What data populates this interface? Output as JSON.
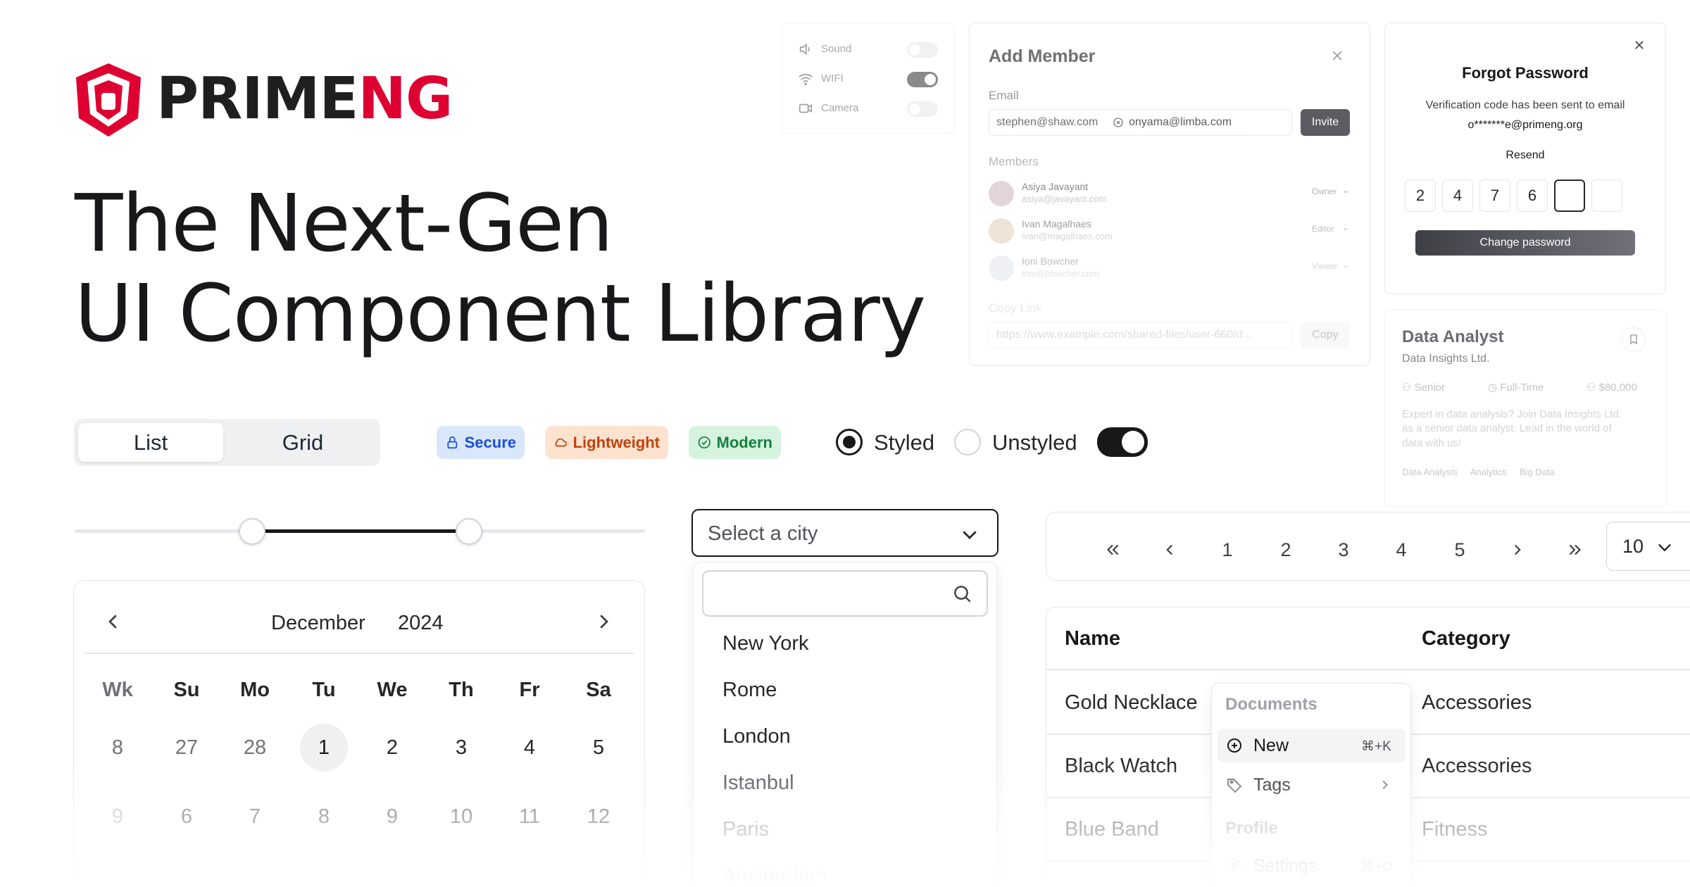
{
  "brand": {
    "prime": "PRIME",
    "ng": "NG"
  },
  "headline": {
    "line1": "The Next-Gen",
    "line2": "UI Component Library"
  },
  "view_toggle": {
    "list": "List",
    "grid": "Grid",
    "selected": "List"
  },
  "tags": [
    {
      "label": "Secure",
      "icon": "lock-icon"
    },
    {
      "label": "Lightweight",
      "icon": "cloud-icon"
    },
    {
      "label": "Modern",
      "icon": "check-circle-icon"
    }
  ],
  "style_mode": {
    "styled": "Styled",
    "unstyled": "Unstyled",
    "selected": "Styled",
    "switch_on": true
  },
  "slider": {
    "min_fraction": 0.31,
    "max_fraction": 0.69
  },
  "calendar": {
    "month": "December",
    "year": "2024",
    "headers": [
      "Wk",
      "Su",
      "Mo",
      "Tu",
      "We",
      "Th",
      "Fr",
      "Sa"
    ],
    "rows": [
      [
        "8",
        "27",
        "28",
        "1",
        "2",
        "3",
        "4",
        "5"
      ],
      [
        "9",
        "6",
        "7",
        "8",
        "9",
        "10",
        "11",
        "12"
      ]
    ],
    "selected_day": "1"
  },
  "city_select": {
    "placeholder": "Select a city",
    "options": [
      "New York",
      "Rome",
      "London",
      "Istanbul",
      "Paris",
      "Amsterdam"
    ]
  },
  "paginator": {
    "pages": [
      "1",
      "2",
      "3",
      "4",
      "5"
    ],
    "rows_per_page": "10"
  },
  "table": {
    "headers": [
      "Name",
      "Category"
    ],
    "rows": [
      [
        "Gold Necklace",
        "Accessories"
      ],
      [
        "Black Watch",
        "Accessories"
      ],
      [
        "Blue Band",
        "Fitness"
      ]
    ]
  },
  "context_menu": {
    "group1": "Documents",
    "items": [
      {
        "label": "New",
        "shortcut": "⌘+K",
        "icon": "plus-circle-icon"
      },
      {
        "label": "Tags",
        "icon": "tag-icon"
      }
    ],
    "group2": "Profile",
    "item3": {
      "label": "Settings",
      "shortcut": "⌘+O"
    }
  },
  "settings_panel": {
    "items": [
      {
        "label": "Sound",
        "on": false,
        "icon": "speaker-icon"
      },
      {
        "label": "WIFI",
        "on": true,
        "icon": "wifi-icon"
      },
      {
        "label": "Camera",
        "on": false,
        "icon": "video-icon"
      }
    ]
  },
  "add_member": {
    "title": "Add Member",
    "email_label": "Email",
    "chip": "stephen@shaw.com",
    "email_value": "onyama@limba.com",
    "invite": "Invite",
    "members_label": "Members",
    "members": [
      {
        "name": "Asiya Javayant",
        "email": "asiya@javayant.com",
        "role": "Owner"
      },
      {
        "name": "Ivan Magalhaes",
        "email": "ivan@magalhaes.com",
        "role": "Editor"
      },
      {
        "name": "Ioni Bowcher",
        "email": "ioni@bowcher.com",
        "role": "Viewer"
      }
    ],
    "copy_link_label": "Copy Link",
    "link": "https://www.example.com/shared-files/user-660/d...",
    "copy": "Copy"
  },
  "forgot_password": {
    "title": "Forgot Password",
    "message": "Verification code has been sent to email",
    "email": "o*******e@primeng.org",
    "resend": "Resend",
    "digits": [
      "2",
      "4",
      "7",
      "6",
      "",
      ""
    ],
    "button": "Change password"
  },
  "job_card": {
    "title": "Data Analyst",
    "company": "Data Insights Ltd.",
    "level": "Senior",
    "type": "Full-Time",
    "salary": "$80,000",
    "description_lines": [
      "Expert in data analysis? Join Data Insights Ltd.",
      "as a senior data analyst. Lead in the world of",
      "data with us!"
    ],
    "chips": [
      "Data Analysis",
      "Analytics",
      "Big Data"
    ]
  },
  "colors": {
    "brand_red": "#dd0031",
    "dark": "#18181b",
    "lock_bg": "#d9e7fb",
    "lock_fg": "#1d4ed8",
    "light_bg": "#fde3cf",
    "light_fg": "#c2410c",
    "modern_bg": "#d6f3df",
    "modern_fg": "#15803d"
  }
}
